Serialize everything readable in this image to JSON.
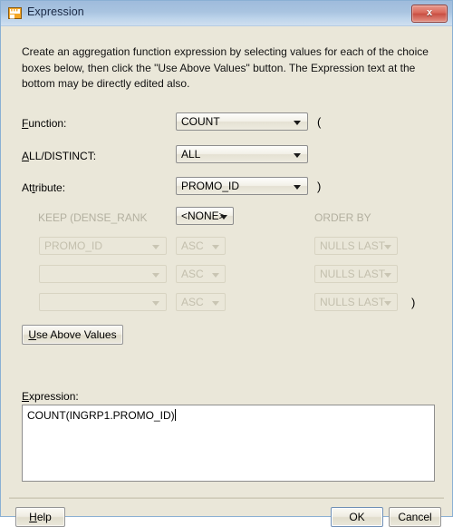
{
  "window": {
    "title": "Expression",
    "icon": "window-app-icon",
    "close_label": "x",
    "titlebar_gradient_from": "#9fbbdc",
    "titlebar_gradient_to": "#cfdff0",
    "client_bg": "#eae7d9",
    "close_button_color": "#c84e41"
  },
  "intro": {
    "text": "Create an aggregation function expression by selecting values for each of the choice boxes below, then click the \"Use Above Values\" button.  The Expression text at the bottom may be directly edited also."
  },
  "form": {
    "function_row": {
      "label": "Function:",
      "label_prefix": "",
      "mnemonic": "F",
      "label_suffix": "unction:",
      "value": "COUNT",
      "paren": "("
    },
    "alldistinct_row": {
      "mnemonic": "A",
      "label_suffix": "LL/DISTINCT:",
      "value": "ALL",
      "paren": ""
    },
    "attribute_row": {
      "label_prefix": "At",
      "mnemonic": "t",
      "label_suffix": "ribute:",
      "value": "PROMO_ID",
      "paren": ")"
    },
    "keep_label": "KEEP (DENSE_RANK",
    "keep_value": "<NONE>",
    "order_by_label": "ORDER BY",
    "order_rows": [
      {
        "attribute": "PROMO_ID",
        "direction": "ASC",
        "nulls": "NULLS LAST",
        "paren": ""
      },
      {
        "attribute": "",
        "direction": "ASC",
        "nulls": "NULLS LAST",
        "paren": ""
      },
      {
        "attribute": "",
        "direction": "ASC",
        "nulls": "NULLS LAST",
        "paren": ")"
      }
    ],
    "use_above_values": {
      "label_prefix": "",
      "mnemonic": "U",
      "label_suffix": "se Above Values"
    }
  },
  "expression": {
    "label_prefix": "",
    "mnemonic": "E",
    "label_suffix": "xpression:",
    "value": "COUNT(INGRP1.PROMO_ID)"
  },
  "footer": {
    "help": {
      "mnemonic": "H",
      "label_prefix": "",
      "label_suffix": "elp"
    },
    "ok": "OK",
    "cancel": "Cancel"
  }
}
